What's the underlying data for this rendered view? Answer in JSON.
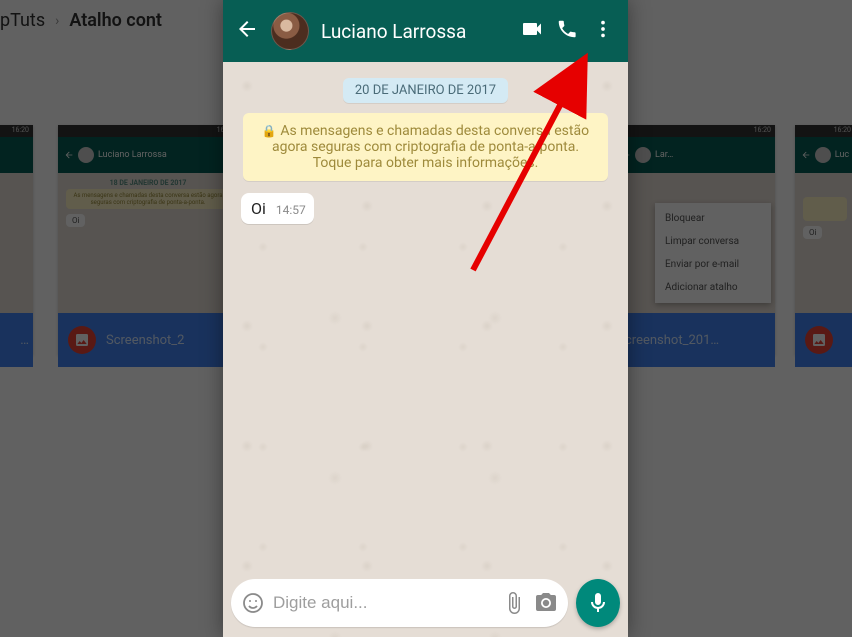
{
  "breadcrumb": {
    "site": "pTuts",
    "page": "Atalho cont"
  },
  "bg_thumb": {
    "status_time": "16:20",
    "contact": "Luciano Larrossa",
    "date": "18 DE JANEIRO DE 2017",
    "enc": "As mensagens e chamadas desta conversa estão agora seguras com criptografia de ponta-a-ponta.",
    "msg": "Oi",
    "caption_left": "Screenshot_2",
    "caption_right": "creenshot_201…",
    "caption_edge": "…"
  },
  "menu": {
    "items": [
      "Bloquear",
      "Limpar conversa",
      "Enviar por e-mail",
      "Adicionar atalho"
    ]
  },
  "chat": {
    "contact_name": "Luciano Larrossa",
    "date_chip": "20 DE JANEIRO DE 2017",
    "encryption_notice": "As mensagens e chamadas desta conversa estão agora seguras com criptografia de ponta-a-ponta. Toque para obter mais informações.",
    "messages": [
      {
        "text": "Oi",
        "time": "14:57"
      }
    ],
    "input_placeholder": "Digite aqui..."
  },
  "colors": {
    "whatsapp_teal": "#075e54",
    "mic_green": "#00897b",
    "arrow_red": "#e60000"
  }
}
